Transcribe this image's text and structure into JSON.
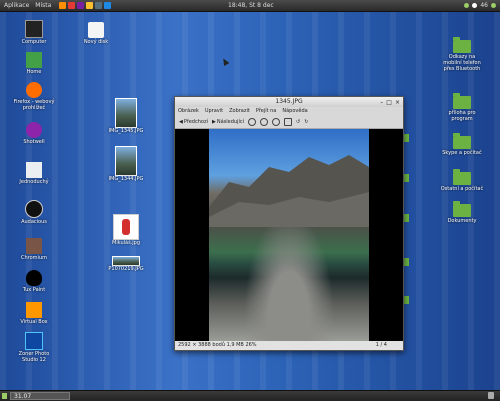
{
  "topbar": {
    "menu_apps": "Aplikace",
    "menu_places": "Místa",
    "clock": "18:48, St 8 dec",
    "tray_battery": "46"
  },
  "desktop_left": [
    {
      "label": "Computer"
    },
    {
      "label": "Home"
    },
    {
      "label": "Firefox - webový prohlížeč"
    },
    {
      "label": "Shotwell"
    },
    {
      "label": "Jednoduchý"
    },
    {
      "label": "Audacious"
    },
    {
      "label": "Chromium"
    },
    {
      "label": "Tux Paint"
    },
    {
      "label": "Virtual Box"
    },
    {
      "label": "Zoner Photo Studio 12"
    }
  ],
  "desktop_top2": {
    "label": "Nový disk"
  },
  "desktop_mid": [
    {
      "label": "IMG_1345.JPG"
    },
    {
      "label": "IMG_1344.JPG"
    },
    {
      "label": "Mikuláš.jpg"
    },
    {
      "label": "P1070219.JPG"
    }
  ],
  "desktop_right": [
    {
      "label": "Odkazy na mobilní telefon přes Bluetooth"
    },
    {
      "label": "příloha pro program"
    },
    {
      "label": "Skype a počítač"
    },
    {
      "label": "Ostatní a počítač"
    },
    {
      "label": "Dokumenty"
    }
  ],
  "viewer": {
    "title": "1345.JPG",
    "menus": [
      "Obrázek",
      "Upravit",
      "Zobrazit",
      "Přejít na",
      "Nápověda"
    ],
    "btn_prev": "Předchozí",
    "btn_next": "Následující",
    "status_left": "2592 × 3888 bodů  1,9 MB  26%",
    "status_page": "1 / 4"
  },
  "taskbar": {
    "task_label": "31.07"
  }
}
